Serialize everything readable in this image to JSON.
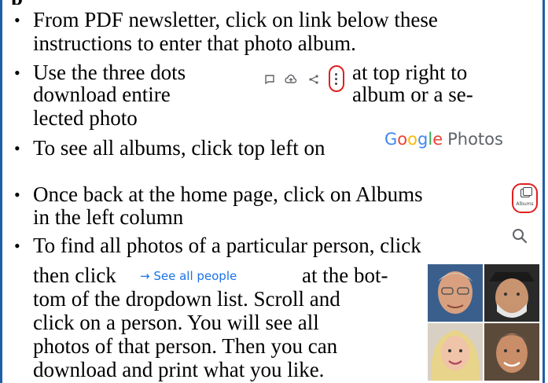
{
  "page": {
    "top_fragment": "p",
    "bullet_char": "•",
    "lines": [
      "From PDF newsletter, click on link below these",
      "instructions to enter that photo album.",
      "Use the three dots",
      "at top right to",
      "download entire",
      "album or a se-",
      "lected photo",
      "To see all albums, click top left on",
      "Once back at the home page, click on Albums",
      "in the left column",
      "To find all photos of a particular person, click",
      "then click",
      "at the bot-",
      "tom of the dropdown list. Scroll and",
      "click on a person. You will see all",
      "photos of that person. Then you can",
      "download and print what you like."
    ]
  },
  "google_photos": {
    "g1": "G",
    "g2": "o",
    "g3": "o",
    "g4": "g",
    "g5": "l",
    "g6": "e",
    "photos": "Photos"
  },
  "icons": {
    "comment": "comment-icon",
    "upload": "cloud-upload-icon",
    "share": "share-icon",
    "more": "three-dots-icon",
    "albums": "albums-icon",
    "search": "search-icon"
  },
  "albums_label": "Albums",
  "see_all_people": "→  See all people",
  "colors": {
    "border": "#1f5fa8",
    "highlight": "#e02020",
    "link": "#1a73e8",
    "icon": "#5f6368"
  }
}
